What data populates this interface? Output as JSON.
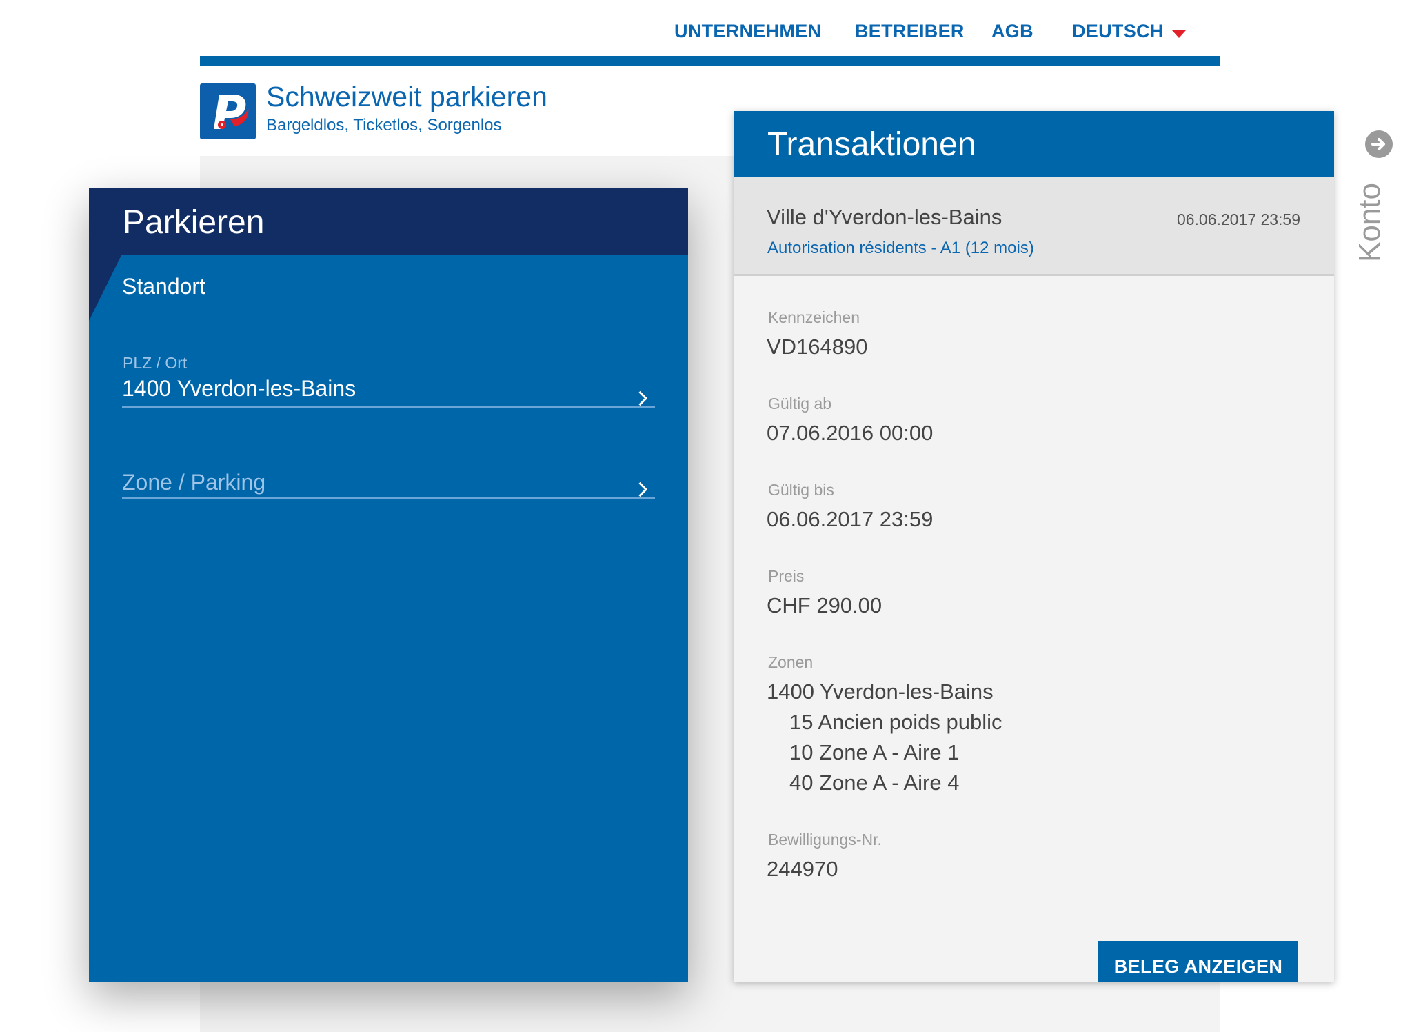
{
  "nav": {
    "items": [
      "UNTERNEHMEN",
      "BETREIBER",
      "AGB"
    ],
    "language": "DEUTSCH"
  },
  "brand": {
    "title": "Schweizweit parkieren",
    "subtitle": "Bargeldlos, Ticketlos, Sorgenlos"
  },
  "parkieren": {
    "title": "Parkieren",
    "section": "Standort",
    "plz_label": "PLZ / Ort",
    "plz_value": "1400 Yverdon-les-Bains",
    "zone_placeholder": "Zone / Parking"
  },
  "transaktionen": {
    "title": "Transaktionen",
    "entry": {
      "city": "Ville d'Yverdon-les-Bains",
      "date": "06.06.2017 23:59",
      "product": "Autorisation résidents - A1 (12 mois)"
    },
    "details": {
      "kennzeichen_label": "Kennzeichen",
      "kennzeichen": "VD164890",
      "gueltig_ab_label": "Gültig ab",
      "gueltig_ab": "07.06.2016 00:00",
      "gueltig_bis_label": "Gültig bis",
      "gueltig_bis": "06.06.2017 23:59",
      "preis_label": "Preis",
      "preis": "CHF 290.00",
      "zonen_label": "Zonen",
      "zonen_ort": "1400 Yverdon-les-Bains",
      "zonen": [
        "15 Ancien poids public",
        "10 Zone A - Aire 1",
        "40 Zone A - Aire 4"
      ],
      "bewilligung_label": "Bewilligungs-Nr.",
      "bewilligung": "244970"
    },
    "button": "BELEG ANZEIGEN"
  },
  "sidebar": {
    "konto": "Konto",
    "icon": "arrow-right-circle-icon"
  },
  "colors": {
    "primary": "#0066aa",
    "dark_header": "#122d63",
    "accent_red": "#e3202a"
  }
}
